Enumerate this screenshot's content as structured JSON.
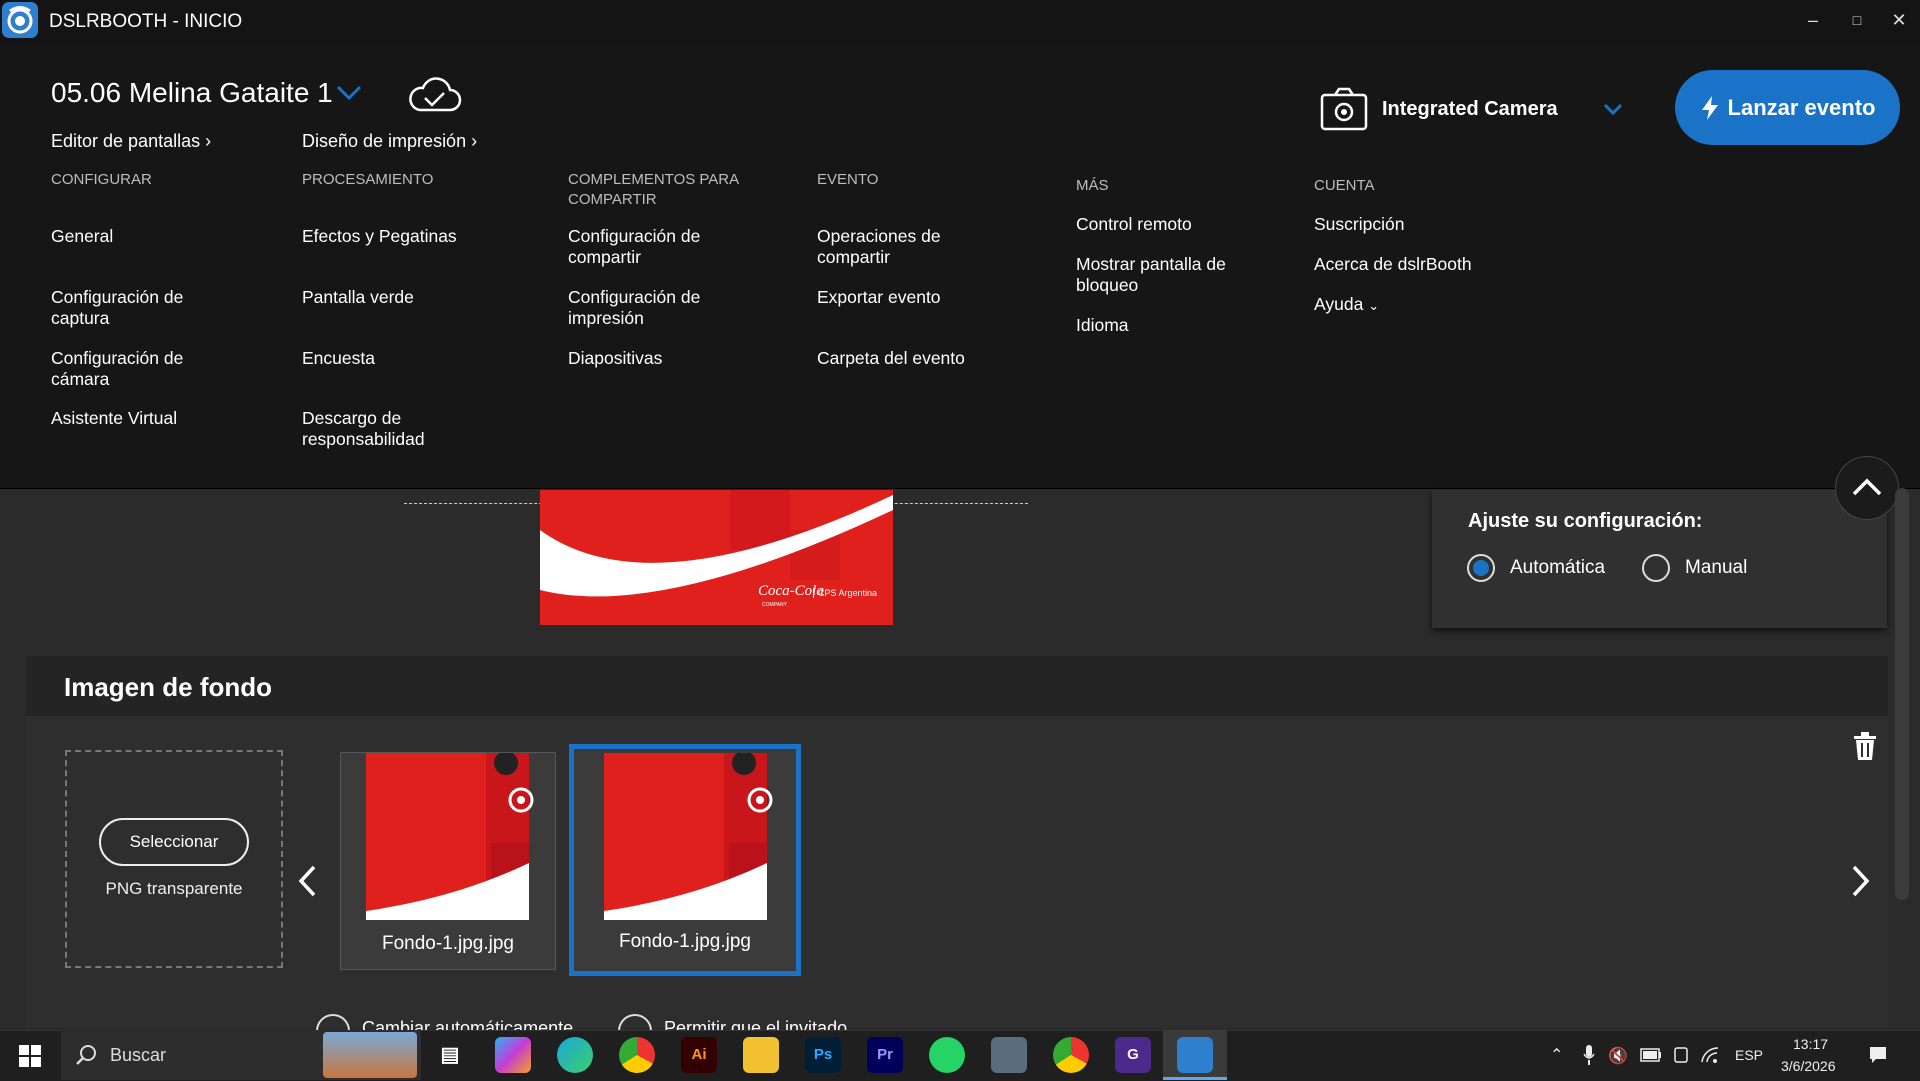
{
  "window": {
    "title": "DSLRBOOTH - INICIO"
  },
  "header": {
    "event_name": "05.06 Melina Gataite 1",
    "screen_editor": "Editor de pantallas",
    "print_design": "Diseño de impresión",
    "camera": "Integrated Camera",
    "launch": "Lanzar evento"
  },
  "menu": {
    "configurar": {
      "title": "CONFIGURAR",
      "items": [
        "General",
        "Configuración de captura",
        "Configuración de cámara",
        "Asistente Virtual"
      ]
    },
    "procesamiento": {
      "title": "PROCESAMIENTO",
      "items": [
        "Efectos y Pegatinas",
        "Pantalla verde",
        "Encuesta",
        "Descargo de responsabilidad"
      ]
    },
    "complementos": {
      "title": "COMPLEMENTOS PARA COMPARTIR",
      "items": [
        "Configuración de compartir",
        "Configuración de impresión",
        "Diapositivas"
      ]
    },
    "evento": {
      "title": "EVENTO",
      "items": [
        "Operaciones de compartir",
        "Exportar evento",
        "Carpeta del evento"
      ]
    },
    "mas": {
      "title": "MÁS",
      "items": [
        "Control remoto",
        "Mostrar pantalla de bloqueo",
        "Idioma"
      ]
    },
    "cuenta": {
      "title": "CUENTA",
      "items": [
        "Suscripción",
        "Acerca de dslrBooth",
        "Ayuda"
      ]
    }
  },
  "settings": {
    "title": "Ajuste su configuración:",
    "options": [
      "Automática",
      "Manual"
    ],
    "selected": "Automática"
  },
  "background": {
    "title": "Imagen de fondo",
    "select_label": "Seleccionar",
    "png_label": "PNG transparente",
    "thumbs": [
      "Fondo-1.jpg.jpg",
      "Fondo-1.jpg.jpg"
    ],
    "selected_index": 1
  },
  "preview": {
    "brand_text": "Coca-Cola",
    "brand_sub": "COMPANY",
    "brand_partner": "CPS Argentina"
  },
  "partial_options": [
    "Cambiar automáticamente",
    "Permitir que el invitado"
  ],
  "taskbar": {
    "search_placeholder": "Buscar",
    "lang": "ESP",
    "time": "13:17",
    "date": "3/6/2026"
  },
  "colors": {
    "accent": "#1a73c7",
    "panel": "#161616",
    "brand_red": "#e0201c"
  }
}
